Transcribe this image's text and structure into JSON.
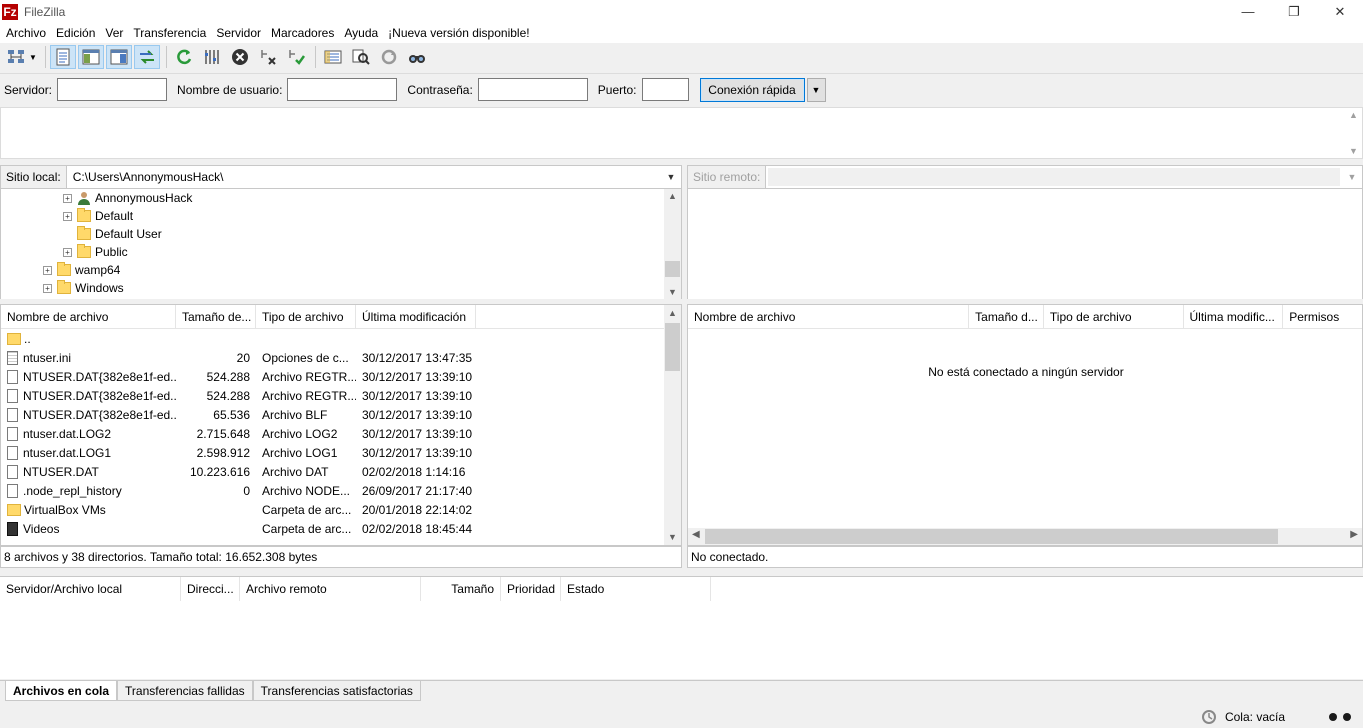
{
  "window": {
    "title": "FileZilla",
    "app_icon": "Fz",
    "minimize": "—",
    "maximize": "❐",
    "close": "✕"
  },
  "menu": [
    "Archivo",
    "Edición",
    "Ver",
    "Transferencia",
    "Servidor",
    "Marcadores",
    "Ayuda",
    "¡Nueva versión disponible!"
  ],
  "toolbar": {
    "icons": [
      "site-manager-icon",
      "toggle-log-icon",
      "toggle-local-tree-icon",
      "toggle-remote-tree-icon",
      "toggle-queue-icon",
      "refresh-icon",
      "process-queue-icon",
      "cancel-icon",
      "disconnect-icon",
      "reconnect-icon",
      "filter-icon",
      "compare-icon",
      "sync-browse-icon",
      "search-icon"
    ]
  },
  "quickconnect": {
    "host_label": "Servidor:",
    "host_value": "",
    "user_label": "Nombre de usuario:",
    "user_value": "",
    "pass_label": "Contraseña:",
    "pass_value": "",
    "port_label": "Puerto:",
    "port_value": "",
    "connect_button": "Conexión rápida",
    "dropdown_arrow": "▼"
  },
  "local": {
    "site_label": "Sitio local:",
    "path": "C:\\Users\\AnnonymousHack\\",
    "tree": [
      {
        "label": "AnnonymousHack",
        "icon": "user",
        "expander": "+",
        "indent": 86
      },
      {
        "label": "Default",
        "icon": "folder",
        "expander": "+",
        "indent": 86
      },
      {
        "label": "Default User",
        "icon": "folder",
        "expander": "",
        "indent": 86
      },
      {
        "label": "Public",
        "icon": "folder",
        "expander": "+",
        "indent": 86
      },
      {
        "label": "wamp64",
        "icon": "folder",
        "expander": "+",
        "indent": 66
      },
      {
        "label": "Windows",
        "icon": "folder",
        "expander": "+",
        "indent": 66
      }
    ],
    "columns": [
      "Nombre de archivo",
      "Tamaño de...",
      "Tipo de archivo",
      "Última modificación"
    ],
    "files": [
      {
        "name": "..",
        "size": "",
        "type": "",
        "modified": "",
        "icon": "folder"
      },
      {
        "name": "ntuser.ini",
        "size": "20",
        "type": "Opciones de c...",
        "modified": "30/12/2017 13:47:35",
        "icon": "cfg"
      },
      {
        "name": "NTUSER.DAT{382e8e1f-ed...",
        "size": "524.288",
        "type": "Archivo REGTR...",
        "modified": "30/12/2017 13:39:10",
        "icon": "file"
      },
      {
        "name": "NTUSER.DAT{382e8e1f-ed...",
        "size": "524.288",
        "type": "Archivo REGTR...",
        "modified": "30/12/2017 13:39:10",
        "icon": "file"
      },
      {
        "name": "NTUSER.DAT{382e8e1f-ed...",
        "size": "65.536",
        "type": "Archivo BLF",
        "modified": "30/12/2017 13:39:10",
        "icon": "file"
      },
      {
        "name": "ntuser.dat.LOG2",
        "size": "2.715.648",
        "type": "Archivo LOG2",
        "modified": "30/12/2017 13:39:10",
        "icon": "file"
      },
      {
        "name": "ntuser.dat.LOG1",
        "size": "2.598.912",
        "type": "Archivo LOG1",
        "modified": "30/12/2017 13:39:10",
        "icon": "file"
      },
      {
        "name": "NTUSER.DAT",
        "size": "10.223.616",
        "type": "Archivo DAT",
        "modified": "02/02/2018 1:14:16",
        "icon": "file"
      },
      {
        "name": ".node_repl_history",
        "size": "0",
        "type": "Archivo NODE...",
        "modified": "26/09/2017 21:17:40",
        "icon": "file"
      },
      {
        "name": "VirtualBox VMs",
        "size": "",
        "type": "Carpeta de arc...",
        "modified": "20/01/2018 22:14:02",
        "icon": "folder"
      },
      {
        "name": "Videos",
        "size": "",
        "type": "Carpeta de arc...",
        "modified": "02/02/2018 18:45:44",
        "icon": "vid"
      }
    ],
    "status": "8 archivos y 38 directorios. Tamaño total: 16.652.308 bytes"
  },
  "remote": {
    "site_label": "Sitio remoto:",
    "columns": [
      "Nombre de archivo",
      "Tamaño d...",
      "Tipo de archivo",
      "Última modific...",
      "Permisos"
    ],
    "empty_message": "No está conectado a ningún servidor",
    "status": "No conectado."
  },
  "queue": {
    "columns": [
      "Servidor/Archivo local",
      "Direcci...",
      "Archivo remoto",
      "Tamaño",
      "Prioridad",
      "Estado"
    ],
    "tabs": [
      "Archivos en cola",
      "Transferencias fallidas",
      "Transferencias satisfactorias"
    ],
    "status": "Cola: vacía"
  },
  "colors": {
    "accent": "#0078d7",
    "folder": "#ffd96a",
    "app_red": "#b50000"
  }
}
